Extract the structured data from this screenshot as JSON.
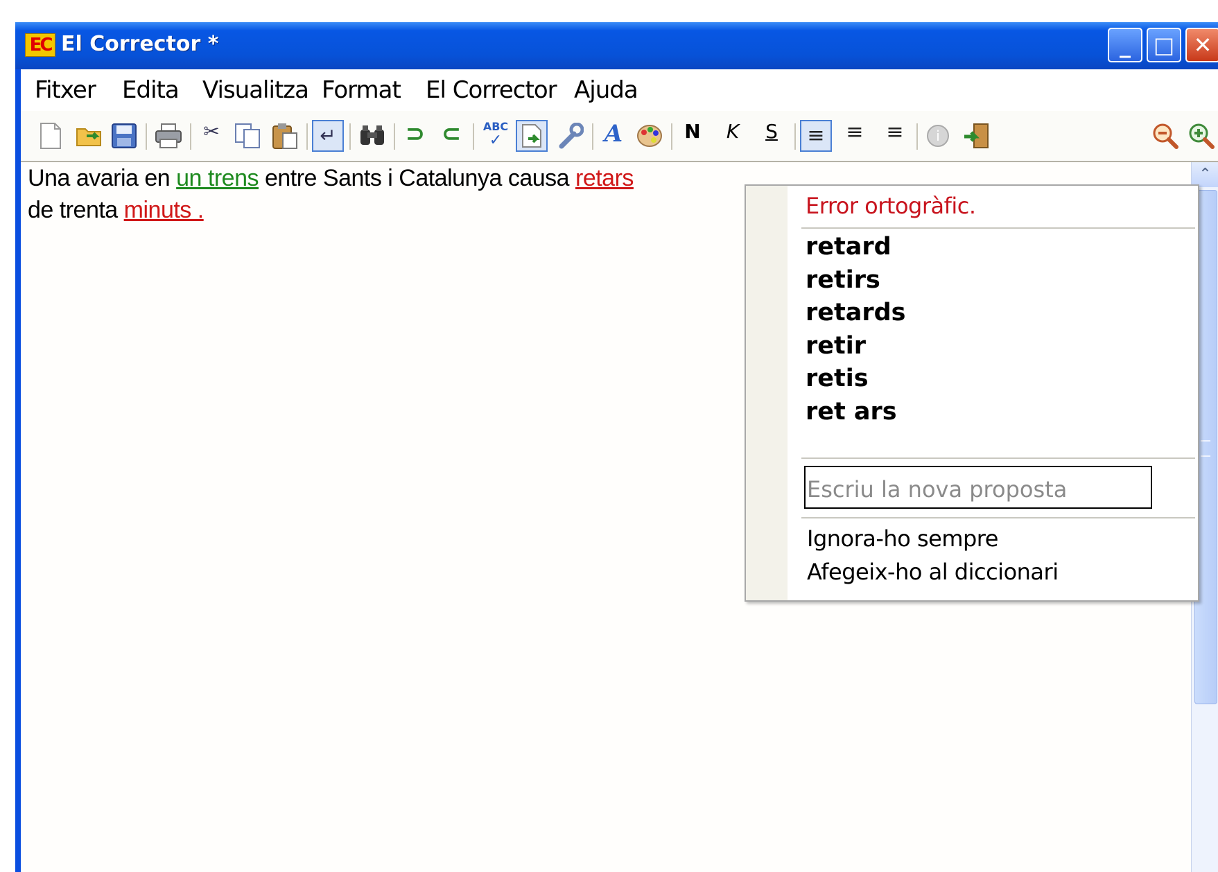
{
  "window": {
    "app_logo": "EC",
    "title": "El Corrector *",
    "controls": {
      "minimize": "minimize",
      "maximize": "maximize",
      "close": "close"
    }
  },
  "menu": [
    "Fitxer",
    "Edita",
    "Visualitza",
    "Format",
    "El Corrector",
    "Ajuda"
  ],
  "toolbar": {
    "buttons": [
      "new-document",
      "open-folder",
      "save",
      "print",
      "cut",
      "copy",
      "paste",
      "insert-return",
      "find",
      "undo",
      "redo",
      "spellcheck-abc",
      "check-document",
      "options-wrench",
      "font",
      "color-palette",
      "bold",
      "italic",
      "underline",
      "align-left",
      "align-center",
      "align-right",
      "help",
      "exit",
      "zoom-out",
      "zoom-in"
    ],
    "bold_label": "N",
    "italic_label": "K",
    "underline_label": "S"
  },
  "document": {
    "line1": {
      "seg1": "Una avaria en ",
      "err1": "un trens",
      "seg2": " entre Sants i Catalunya causa ",
      "err2": "retars"
    },
    "line2": {
      "seg1": "de trenta ",
      "err1": "minuts ."
    },
    "colors": {
      "grammar_error": "#1e8a1e",
      "spelling_error": "#d01818"
    }
  },
  "context_menu": {
    "header": "Error ortogràfic.",
    "suggestions": [
      "retard",
      "retirs",
      "retards",
      "retir",
      "retis",
      "ret ars"
    ],
    "input_placeholder": "Escriu la nova proposta",
    "input_value": "",
    "ignore_label": "Ignora-ho sempre",
    "add_label": "Afegeix-ho al diccionari",
    "header_color": "#c8141e"
  }
}
